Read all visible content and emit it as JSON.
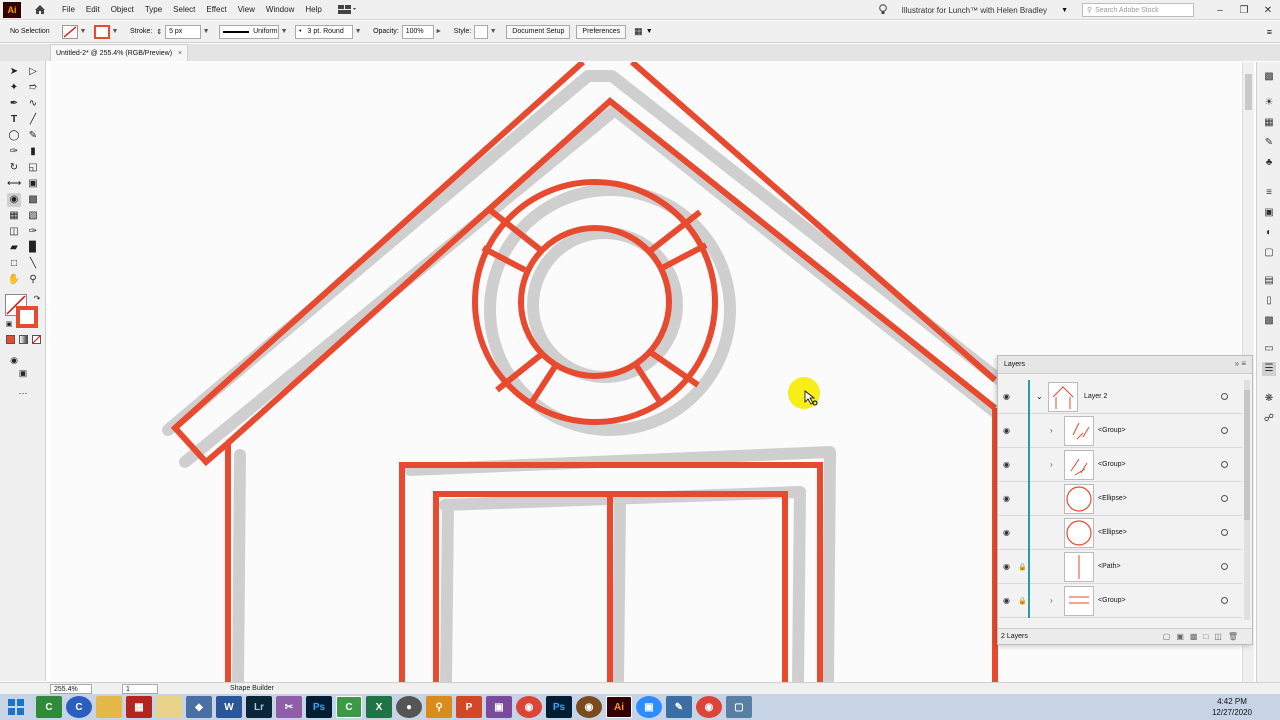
{
  "app": {
    "logo": "Ai",
    "menu": [
      "File",
      "Edit",
      "Object",
      "Type",
      "Select",
      "Effect",
      "View",
      "Window",
      "Help"
    ],
    "learn_title": "Illustrator for Lunch™ with Helen Bradley",
    "search_placeholder": "Search Adobe Stock"
  },
  "control_bar": {
    "selection": "No Selection",
    "stroke_label": "Stroke:",
    "stroke_value": "5 px",
    "profile": "Uniform",
    "brush": "3 pt. Round",
    "opacity_label": "Opacity:",
    "opacity_value": "100%",
    "style_label": "Style:",
    "doc_setup": "Document Setup",
    "preferences": "Preferences"
  },
  "document": {
    "tab_title": "Untitled-2* @ 255.4% (RGB/Preview)",
    "close": "×"
  },
  "layers_panel": {
    "title": "Layers",
    "rows": [
      {
        "name": "Layer 2",
        "kind": "layer"
      },
      {
        "name": "<Group>",
        "kind": "group"
      },
      {
        "name": "<Group>",
        "kind": "group"
      },
      {
        "name": "<Ellipse>",
        "kind": "ellipse"
      },
      {
        "name": "<Ellipse>",
        "kind": "ellipse"
      },
      {
        "name": "<Path>",
        "kind": "path"
      },
      {
        "name": "<Group>",
        "kind": "group"
      }
    ],
    "footer": "2 Layers"
  },
  "status_bar": {
    "zoom": "255.4%",
    "page": "1",
    "current_tool": "Shape Builder"
  },
  "taskbar": {
    "time": "4:42 PM",
    "date": "12/27/2020"
  },
  "colors": {
    "stroke": "#e84a2f",
    "shadow": "#c8c8c8",
    "layer_accent": "#2a9aa5"
  }
}
